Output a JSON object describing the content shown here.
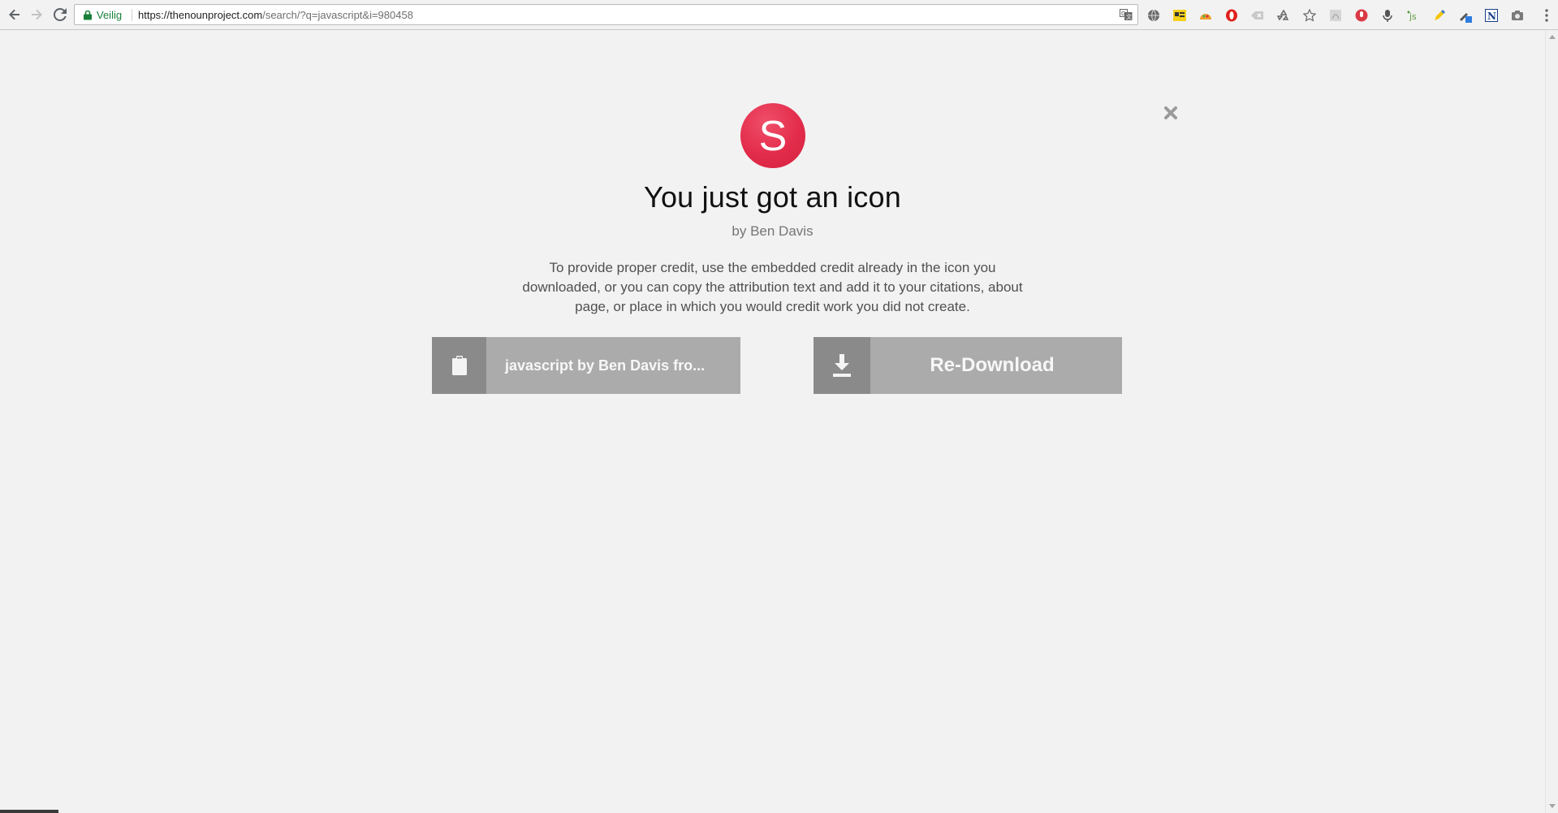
{
  "browser": {
    "secure_label": "Veilig",
    "url_host": "https://thenounproject.com",
    "url_path": "/search/?q=javascript&i=980458",
    "extensions": [
      "globe-icon",
      "id-card-icon",
      "taco-icon",
      "opera-icon",
      "tab-close-icon",
      "recycle-icon",
      "star-icon",
      "pdf-icon",
      "microphone-red-icon",
      "microphone-icon",
      "js-icon",
      "pencil-color-icon",
      "eyedropper-icon",
      "noun-n-icon",
      "camera-icon"
    ]
  },
  "modal": {
    "logo_letter": "S",
    "title": "You just got an icon",
    "byline": "by Ben Davis",
    "description": "To provide proper credit, use the embedded credit already in the icon you downloaded, or you can copy the attribution text and add it to your citations, about page, or place in which you would credit work you did not create.",
    "copy_button_label": "javascript by Ben Davis fro...",
    "download_button_label": "Re-Download",
    "colors": {
      "logo": "#e32c4b",
      "button_bg": "#ababab",
      "button_icon_bg": "#8a8a8a",
      "page_bg": "#f2f2f2"
    }
  }
}
